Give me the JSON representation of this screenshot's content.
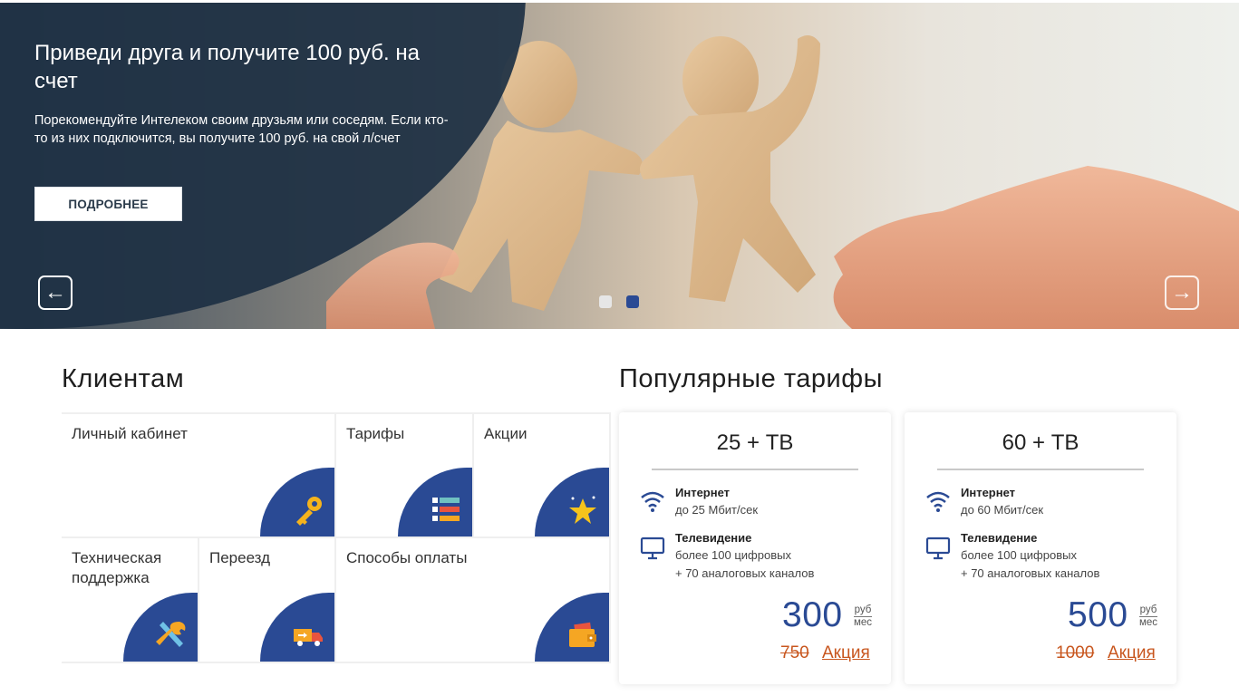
{
  "hero": {
    "title": "Приведи друга и получите 100 руб. на счет",
    "text": "Порекомендуйте Интелеком своим друзьям или соседям. Если кто-то из них подключится, вы получите 100 руб. на свой л/счет",
    "button_label": "ПОДРОБНЕЕ",
    "prev_arrow": "←",
    "next_arrow": "→",
    "slides_count": 2,
    "active_slide": 2
  },
  "clients": {
    "title": "Клиентам",
    "tiles": [
      {
        "label": "Личный кабинет",
        "icon": "key-icon"
      },
      {
        "label": "Тарифы",
        "icon": "price-tags-icon"
      },
      {
        "label": "Акции",
        "icon": "star-icon"
      },
      {
        "label": "Техническая поддержка",
        "icon": "tools-icon"
      },
      {
        "label": "Переезд",
        "icon": "moving-truck-icon"
      },
      {
        "label": "Способы оплаты",
        "icon": "wallet-icon"
      }
    ]
  },
  "tariffs": {
    "title": "Популярные тарифы",
    "cards": [
      {
        "name": "25 + ТВ",
        "internet_title": "Интернет",
        "internet_text": "до 25 Мбит/сек",
        "tv_title": "Телевидение",
        "tv_line1": "более 100 цифровых",
        "tv_line2": "+ 70 аналоговых каналов",
        "price": "300",
        "price_unit_top": "руб",
        "price_unit_bottom": "мес",
        "old_price": "750",
        "promo": "Акция"
      },
      {
        "name": "60 + ТВ",
        "internet_title": "Интернет",
        "internet_text": "до 60 Мбит/сек",
        "tv_title": "Телевидение",
        "tv_line1": "более 100 цифровых",
        "tv_line2": "+ 70 аналоговых каналов",
        "price": "500",
        "price_unit_top": "руб",
        "price_unit_bottom": "мес",
        "old_price": "1000",
        "promo": "Акция"
      }
    ]
  },
  "colors": {
    "brand_blue": "#2a4a94",
    "hero_panel": "#1e3044",
    "promo_orange": "#c8561e"
  }
}
